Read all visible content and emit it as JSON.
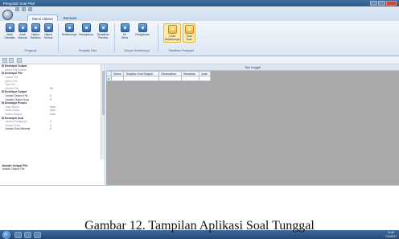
{
  "window": {
    "title": "Pengolah Soal Pilot"
  },
  "tabs": [
    {
      "label": "Menu Utama"
    },
    {
      "label": "Bantuan"
    }
  ],
  "ribbon": {
    "buttons": [
      {
        "label": "Acak\nOtomatis",
        "icon": "dice-icon"
      },
      {
        "label": "Acak\nManual",
        "icon": "shuffle-icon"
      },
      {
        "label": "Hapus\nRandom",
        "icon": "erase-icon"
      },
      {
        "label": "Hapus\nSemua",
        "icon": "trash-icon"
      },
      {
        "label": "Sebelumnya",
        "icon": "prev-icon"
      },
      {
        "label": "Selanjutnya",
        "icon": "next-icon"
      },
      {
        "label": "Tampilkan\nPreview",
        "icon": "preview-icon"
      },
      {
        "label": "Ke\nWord",
        "icon": "word-icon"
      },
      {
        "label": "Pengaturan",
        "icon": "settings-icon"
      },
      {
        "label": "Lihat\nSebelumnya",
        "icon": "view-icon"
      },
      {
        "label": "Soal\nSoal",
        "icon": "question-icon"
      }
    ],
    "groups": [
      {
        "label": "Pengacak"
      },
      {
        "label": "Pengolah Data"
      },
      {
        "label": "Simpan Sebelumnya"
      },
      {
        "label": "Tampilkan Pengingat"
      }
    ]
  },
  "properties": {
    "rows": [
      {
        "k": "Deskripsi Output",
        "v": "",
        "type": "cat"
      },
      {
        "k": "Nama File Disetel",
        "v": "",
        "type": "row"
      },
      {
        "k": "Deskripsi File",
        "v": "",
        "type": "cat"
      },
      {
        "k": "Lokasi File",
        "v": "",
        "type": "row"
      },
      {
        "k": "Nama File",
        "v": "",
        "type": "row"
      },
      {
        "k": "Tipe File",
        "v": "",
        "type": "row"
      },
      {
        "k": "Ukuran File",
        "v": "Kb",
        "type": "row"
      },
      {
        "k": "Deskripsi Output",
        "v": "",
        "type": "cat"
      },
      {
        "k": "Jumlah Output File",
        "v": "1",
        "type": "bold"
      },
      {
        "k": "Jumlah Output Soal",
        "v": "2",
        "type": "bold"
      },
      {
        "k": "Deskripsi Proses",
        "v": "",
        "type": "cat"
      },
      {
        "k": "Total Waktu",
        "v": "0sec",
        "type": "row"
      },
      {
        "k": "Waktu Baca",
        "v": "0sec",
        "type": "row"
      },
      {
        "k": "Waktu Simpan",
        "v": "0sec",
        "type": "row"
      },
      {
        "k": "Deskripsi Soal",
        "v": "",
        "type": "cat"
      },
      {
        "k": "Jumlah Paragraph",
        "v": "0",
        "type": "row"
      },
      {
        "k": "Jumlah Soal",
        "v": "0",
        "type": "row"
      },
      {
        "k": "Jumlah Soal Minimal",
        "v": "2",
        "type": "bold"
      }
    ],
    "desc_title": "Jumlah Output File",
    "desc_text": "Jumlah Output File"
  },
  "grid": {
    "caption": "Tipe tunggal",
    "columns": [
      "Nomor",
      "Tampilan Soal Singkat",
      "Dimasukkan",
      "Benardan",
      "Acak"
    ],
    "row_marker": "▸"
  },
  "figure_caption": "Gambar 12. Tampilan Aplikasi Soal Tunggal",
  "taskbar": {
    "time": "11:48",
    "date": "7/14/2017"
  }
}
